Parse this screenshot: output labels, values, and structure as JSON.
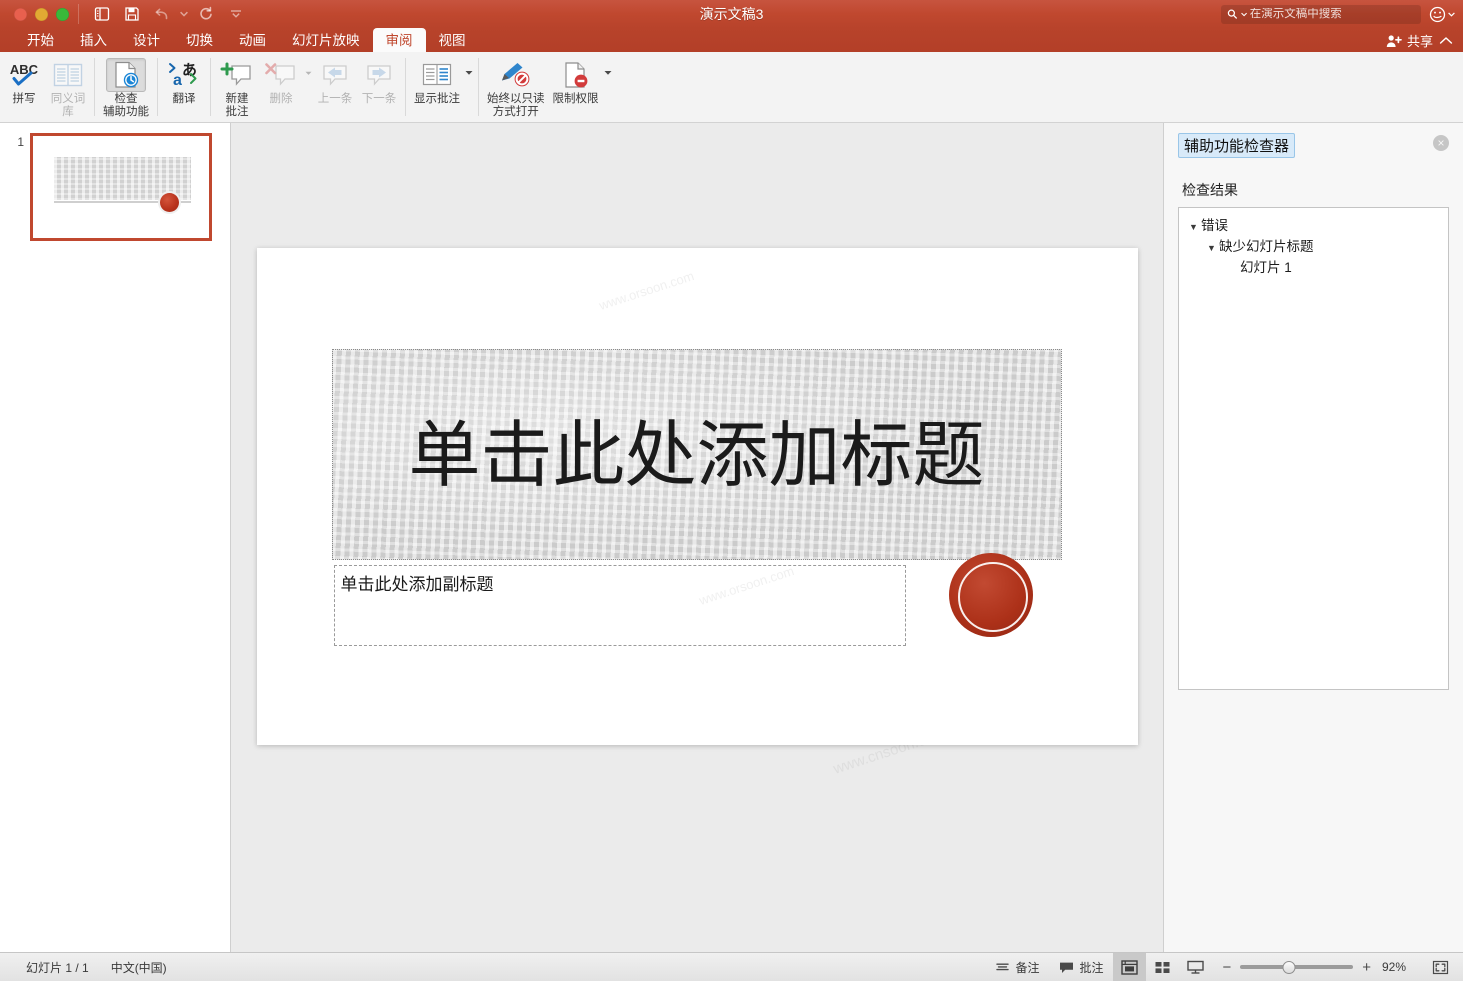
{
  "app": {
    "document_title": "演示文稿3",
    "accent_color": "#c0482f",
    "titlebar_color": "#b8432b"
  },
  "titlebar": {
    "window_controls": [
      "close",
      "minimize",
      "zoom"
    ],
    "quick_access": [
      {
        "name": "sidebar-toggle",
        "label": "显示/隐藏侧边栏"
      },
      {
        "name": "save",
        "label": "保存"
      },
      {
        "name": "undo",
        "label": "撤消"
      },
      {
        "name": "redo",
        "label": "恢复"
      },
      {
        "name": "customize-toolbar",
        "label": "自定义工具栏"
      }
    ],
    "search": {
      "placeholder": "在演示文稿中搜索",
      "value": ""
    },
    "smiley_label": "发送反馈"
  },
  "tabs": {
    "items": [
      {
        "label": "开始",
        "active": false
      },
      {
        "label": "插入",
        "active": false
      },
      {
        "label": "设计",
        "active": false
      },
      {
        "label": "切换",
        "active": false
      },
      {
        "label": "动画",
        "active": false
      },
      {
        "label": "幻灯片放映",
        "active": false
      },
      {
        "label": "审阅",
        "active": true
      },
      {
        "label": "视图",
        "active": false
      }
    ],
    "share_label": "共享",
    "collapse_label": "折叠功能区"
  },
  "ribbon": {
    "groups": [
      {
        "name": "proofing",
        "buttons": [
          {
            "label_lines": [
              "拼写"
            ],
            "icon": "spelling-icon",
            "state": "normal"
          },
          {
            "label_lines": [
              "同义词",
              "库"
            ],
            "icon": "thesaurus-icon",
            "state": "disabled"
          }
        ]
      },
      {
        "name": "accessibility",
        "buttons": [
          {
            "label_lines": [
              "检查",
              "辅助功能"
            ],
            "icon": "check-accessibility-icon",
            "state": "pressed"
          }
        ]
      },
      {
        "name": "language",
        "buttons": [
          {
            "label_lines": [
              "翻译"
            ],
            "icon": "translate-icon",
            "state": "normal"
          }
        ]
      },
      {
        "name": "comments",
        "buttons": [
          {
            "label_lines": [
              "新建",
              "批注"
            ],
            "icon": "new-comment-icon",
            "state": "normal"
          },
          {
            "label_lines": [
              "删除"
            ],
            "icon": "delete-comment-icon",
            "state": "disabled",
            "has_caret": true
          },
          {
            "label_lines": [
              "上一条"
            ],
            "icon": "previous-comment-icon",
            "state": "disabled"
          },
          {
            "label_lines": [
              "下一条"
            ],
            "icon": "next-comment-icon",
            "state": "disabled"
          }
        ]
      },
      {
        "name": "show-comments",
        "buttons": [
          {
            "label_lines": [
              "显示批注"
            ],
            "icon": "show-comments-icon",
            "state": "normal",
            "has_caret": true
          }
        ]
      },
      {
        "name": "protect",
        "buttons": [
          {
            "label_lines": [
              "始终以只读",
              "方式打开"
            ],
            "icon": "open-read-only-icon",
            "state": "normal"
          },
          {
            "label_lines": [
              "限制权限"
            ],
            "icon": "restrict-permission-icon",
            "state": "normal",
            "has_caret": true
          }
        ]
      }
    ]
  },
  "thumbnails": {
    "slides": [
      {
        "number": "1",
        "selected": true
      }
    ]
  },
  "slide": {
    "title_placeholder": "单击此处添加标题",
    "subtitle_placeholder": "单击此处添加副标题",
    "stamp_name": "red-seal-stamp"
  },
  "accessibility_panel": {
    "title": "辅助功能检查器",
    "close_label": "×",
    "results_label": "检查结果",
    "tree": [
      {
        "level": 1,
        "label": "错误",
        "expanded": true
      },
      {
        "level": 2,
        "label": "缺少幻灯片标题",
        "expanded": true
      },
      {
        "level": 3,
        "label": "幻灯片 1",
        "expanded": false
      }
    ]
  },
  "statusbar": {
    "slide_count": "幻灯片 1 / 1",
    "language": "中文(中国)",
    "notes_label": "备注",
    "comments_label": "批注",
    "views": [
      {
        "name": "normal-view",
        "label": "普通视图",
        "active": true
      },
      {
        "name": "slide-sorter-view",
        "label": "幻灯片浏览",
        "active": false
      },
      {
        "name": "reading-view",
        "label": "阅读视图",
        "active": false
      }
    ],
    "zoom_out_label": "−",
    "zoom_in_label": "+",
    "zoom_value": "92%",
    "fit_label": "使幻灯片适应当前窗口"
  },
  "watermarks": [
    "www.cnsoon.com",
    "www.orsoon.com"
  ]
}
